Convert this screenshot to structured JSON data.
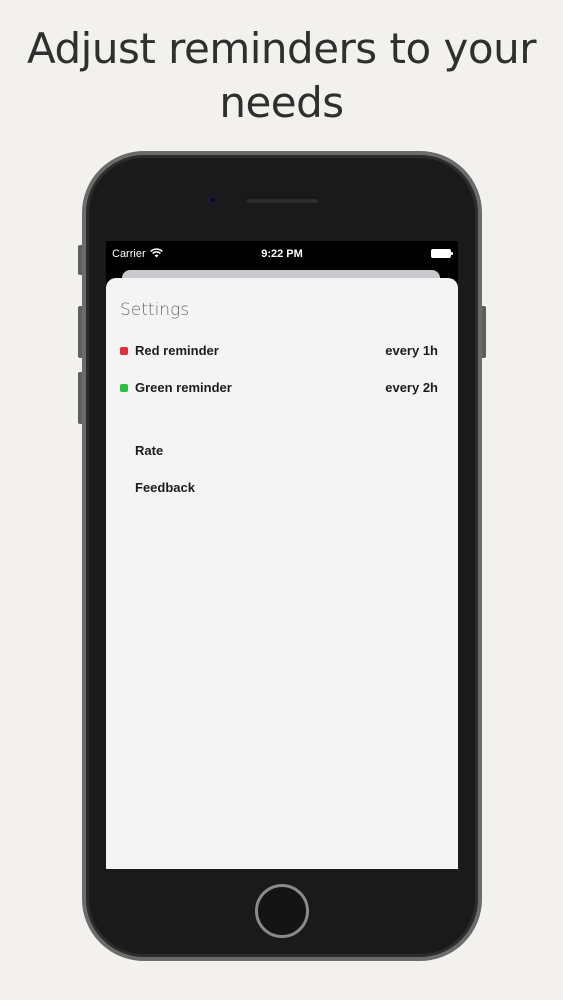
{
  "headline": {
    "line1": "Adjust reminders to your",
    "line2": "needs"
  },
  "status_bar": {
    "carrier": "Carrier",
    "time": "9:22 PM",
    "icons": [
      "wifi-icon",
      "battery-icon"
    ]
  },
  "settings": {
    "title": "Settings",
    "reminders": [
      {
        "label": "Red reminder",
        "interval": "every 1h",
        "color": "#e0303a"
      },
      {
        "label": "Green reminder",
        "interval": "every 2h",
        "color": "#2fbd45"
      }
    ],
    "actions": [
      {
        "label": "Rate"
      },
      {
        "label": "Feedback"
      }
    ]
  },
  "colors": {
    "background": "#f2f1ee",
    "sheet": "#f4f4f5"
  }
}
